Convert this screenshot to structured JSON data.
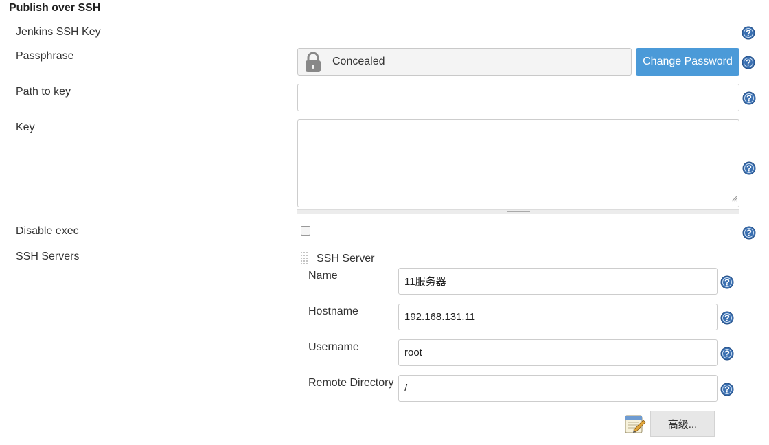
{
  "section": {
    "title": "Publish over SSH"
  },
  "fields": {
    "jenkins_ssh_key": {
      "label": "Jenkins SSH Key"
    },
    "passphrase": {
      "label": "Passphrase",
      "value": "Concealed",
      "button": "Change Password"
    },
    "path_to_key": {
      "label": "Path to key",
      "value": ""
    },
    "key": {
      "label": "Key",
      "value": ""
    },
    "disable_exec": {
      "label": "Disable exec",
      "checked": false
    },
    "ssh_servers": {
      "label": "SSH Servers"
    }
  },
  "server": {
    "header": "SSH Server",
    "name": {
      "label": "Name",
      "value": "11服务器"
    },
    "hostname": {
      "label": "Hostname",
      "value": "192.168.131.11"
    },
    "username": {
      "label": "Username",
      "value": "root"
    },
    "remote_directory": {
      "label": "Remote Directory",
      "value": "/"
    },
    "advanced_button": "高级..."
  },
  "colors": {
    "primary_button": "#4b9ad8",
    "help_icon": "#3a6fb0"
  },
  "icons": [
    "help-icon",
    "lock-icon",
    "drag-handle-icon",
    "notepad-icon",
    "resize-grip-icon"
  ]
}
